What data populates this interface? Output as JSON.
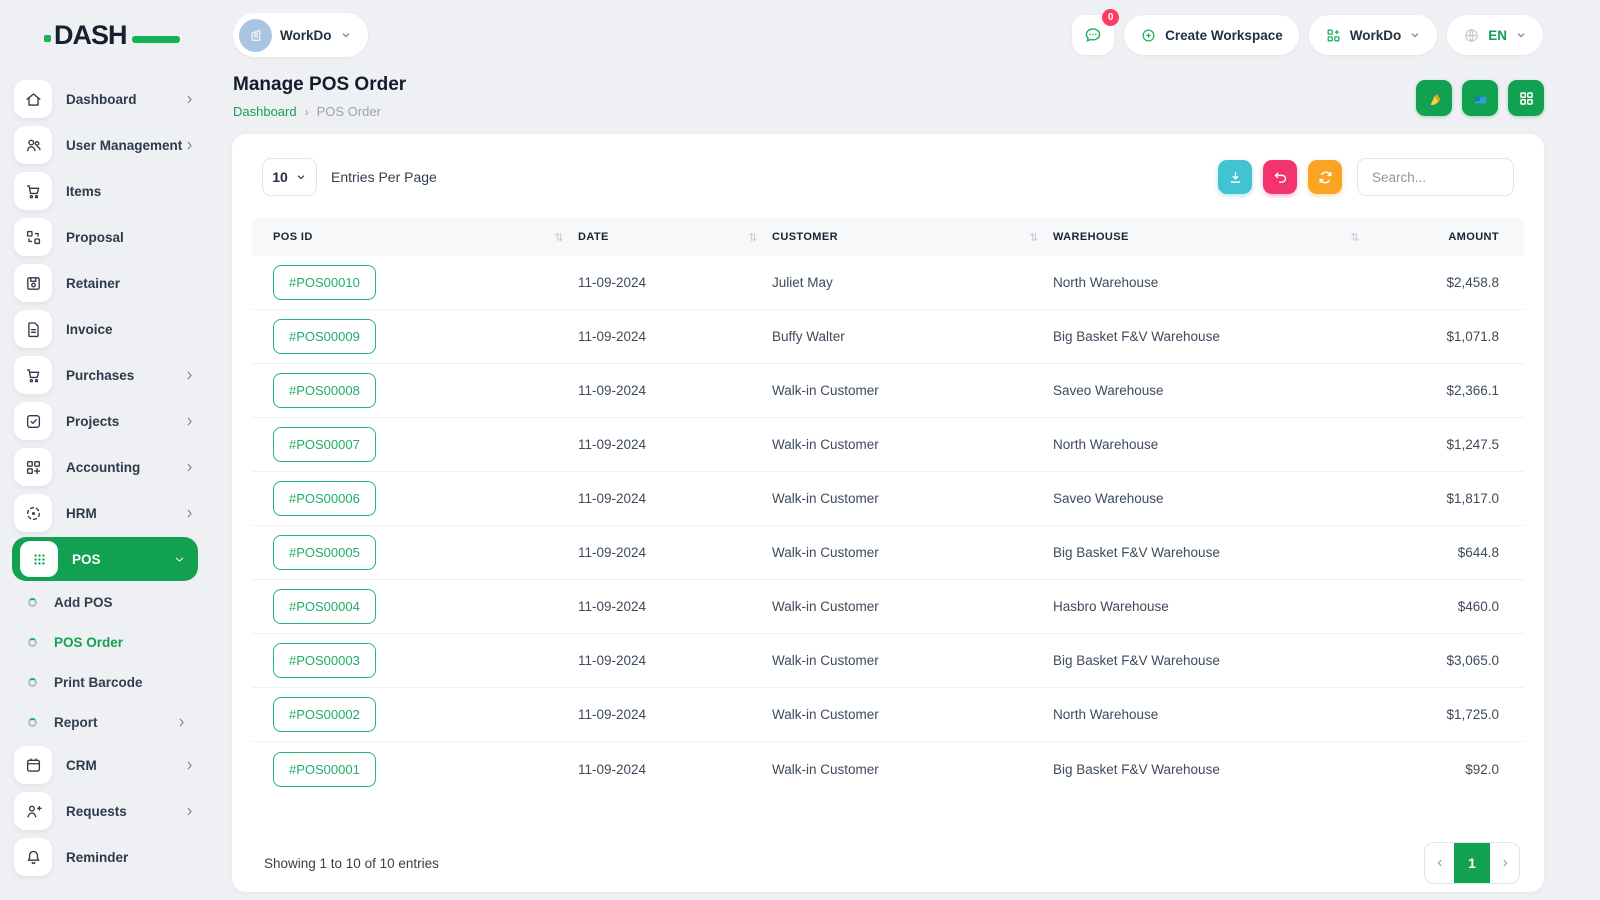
{
  "brand": {
    "name": "DASH",
    "accent_green": "#12a150",
    "navy": "#16202e"
  },
  "topbar": {
    "workspace_selector_label": "WorkDo",
    "messages_badge_count": "0",
    "create_workspace_label": "Create Workspace",
    "company_menu_label": "WorkDo",
    "language_code": "EN"
  },
  "sidebar": {
    "items": [
      {
        "label": "Dashboard",
        "icon": "home-icon",
        "chevron": "right"
      },
      {
        "label": "User Management",
        "icon": "users-icon",
        "chevron": "right"
      },
      {
        "label": "Items",
        "icon": "cart-icon"
      },
      {
        "label": "Proposal",
        "icon": "proposal-icon"
      },
      {
        "label": "Retainer",
        "icon": "retainer-icon"
      },
      {
        "label": "Invoice",
        "icon": "invoice-icon"
      },
      {
        "label": "Purchases",
        "icon": "purchases-icon",
        "chevron": "right"
      },
      {
        "label": "Projects",
        "icon": "projects-icon",
        "chevron": "right"
      },
      {
        "label": "Accounting",
        "icon": "accounting-icon",
        "chevron": "right"
      },
      {
        "label": "HRM",
        "icon": "hrm-icon",
        "chevron": "right"
      },
      {
        "label": "POS",
        "icon": "pos-icon",
        "chevron": "down",
        "active": true
      },
      {
        "label": "Add POS",
        "type": "sub"
      },
      {
        "label": "POS Order",
        "type": "sub",
        "active": true
      },
      {
        "label": "Print Barcode",
        "type": "sub"
      },
      {
        "label": "Report",
        "type": "sub",
        "chevron": "right"
      },
      {
        "label": "CRM",
        "icon": "crm-icon",
        "chevron": "right"
      },
      {
        "label": "Requests",
        "icon": "requests-icon",
        "chevron": "right"
      },
      {
        "label": "Reminder",
        "icon": "reminder-icon"
      }
    ]
  },
  "page": {
    "title": "Manage POS Order",
    "breadcrumb": {
      "parent": "Dashboard",
      "separator": "›",
      "current": "POS Order"
    }
  },
  "toolbar": {
    "entries_per_page_value": "10",
    "entries_per_page_label": "Entries Per Page",
    "search_placeholder": "Search..."
  },
  "table": {
    "columns": [
      "POS ID",
      "DATE",
      "CUSTOMER",
      "WAREHOUSE",
      "AMOUNT"
    ],
    "rows": [
      {
        "pos_id": "#POS00010",
        "date": "11-09-2024",
        "customer": "Juliet May",
        "warehouse": "North Warehouse",
        "amount": "$2,458.8"
      },
      {
        "pos_id": "#POS00009",
        "date": "11-09-2024",
        "customer": "Buffy Walter",
        "warehouse": "Big Basket F&V Warehouse",
        "amount": "$1,071.8"
      },
      {
        "pos_id": "#POS00008",
        "date": "11-09-2024",
        "customer": "Walk-in Customer",
        "warehouse": "Saveo Warehouse",
        "amount": "$2,366.1"
      },
      {
        "pos_id": "#POS00007",
        "date": "11-09-2024",
        "customer": "Walk-in Customer",
        "warehouse": "North Warehouse",
        "amount": "$1,247.5"
      },
      {
        "pos_id": "#POS00006",
        "date": "11-09-2024",
        "customer": "Walk-in Customer",
        "warehouse": "Saveo Warehouse",
        "amount": "$1,817.0"
      },
      {
        "pos_id": "#POS00005",
        "date": "11-09-2024",
        "customer": "Walk-in Customer",
        "warehouse": "Big Basket F&V Warehouse",
        "amount": "$644.8"
      },
      {
        "pos_id": "#POS00004",
        "date": "11-09-2024",
        "customer": "Walk-in Customer",
        "warehouse": "Hasbro Warehouse",
        "amount": "$460.0"
      },
      {
        "pos_id": "#POS00003",
        "date": "11-09-2024",
        "customer": "Walk-in Customer",
        "warehouse": "Big Basket F&V Warehouse",
        "amount": "$3,065.0"
      },
      {
        "pos_id": "#POS00002",
        "date": "11-09-2024",
        "customer": "Walk-in Customer",
        "warehouse": "North Warehouse",
        "amount": "$1,725.0"
      },
      {
        "pos_id": "#POS00001",
        "date": "11-09-2024",
        "customer": "Walk-in Customer",
        "warehouse": "Big Basket F&V Warehouse",
        "amount": "$92.0"
      }
    ]
  },
  "footer": {
    "summary": "Showing 1 to 10 of 10 entries",
    "current_page": "1"
  },
  "colors": {
    "accent": "#12a150",
    "teal": "#41c3d2",
    "pink": "#f2336d",
    "orange": "#f9a422",
    "badge_red": "#fd3c64",
    "background": "#eef0f4"
  }
}
